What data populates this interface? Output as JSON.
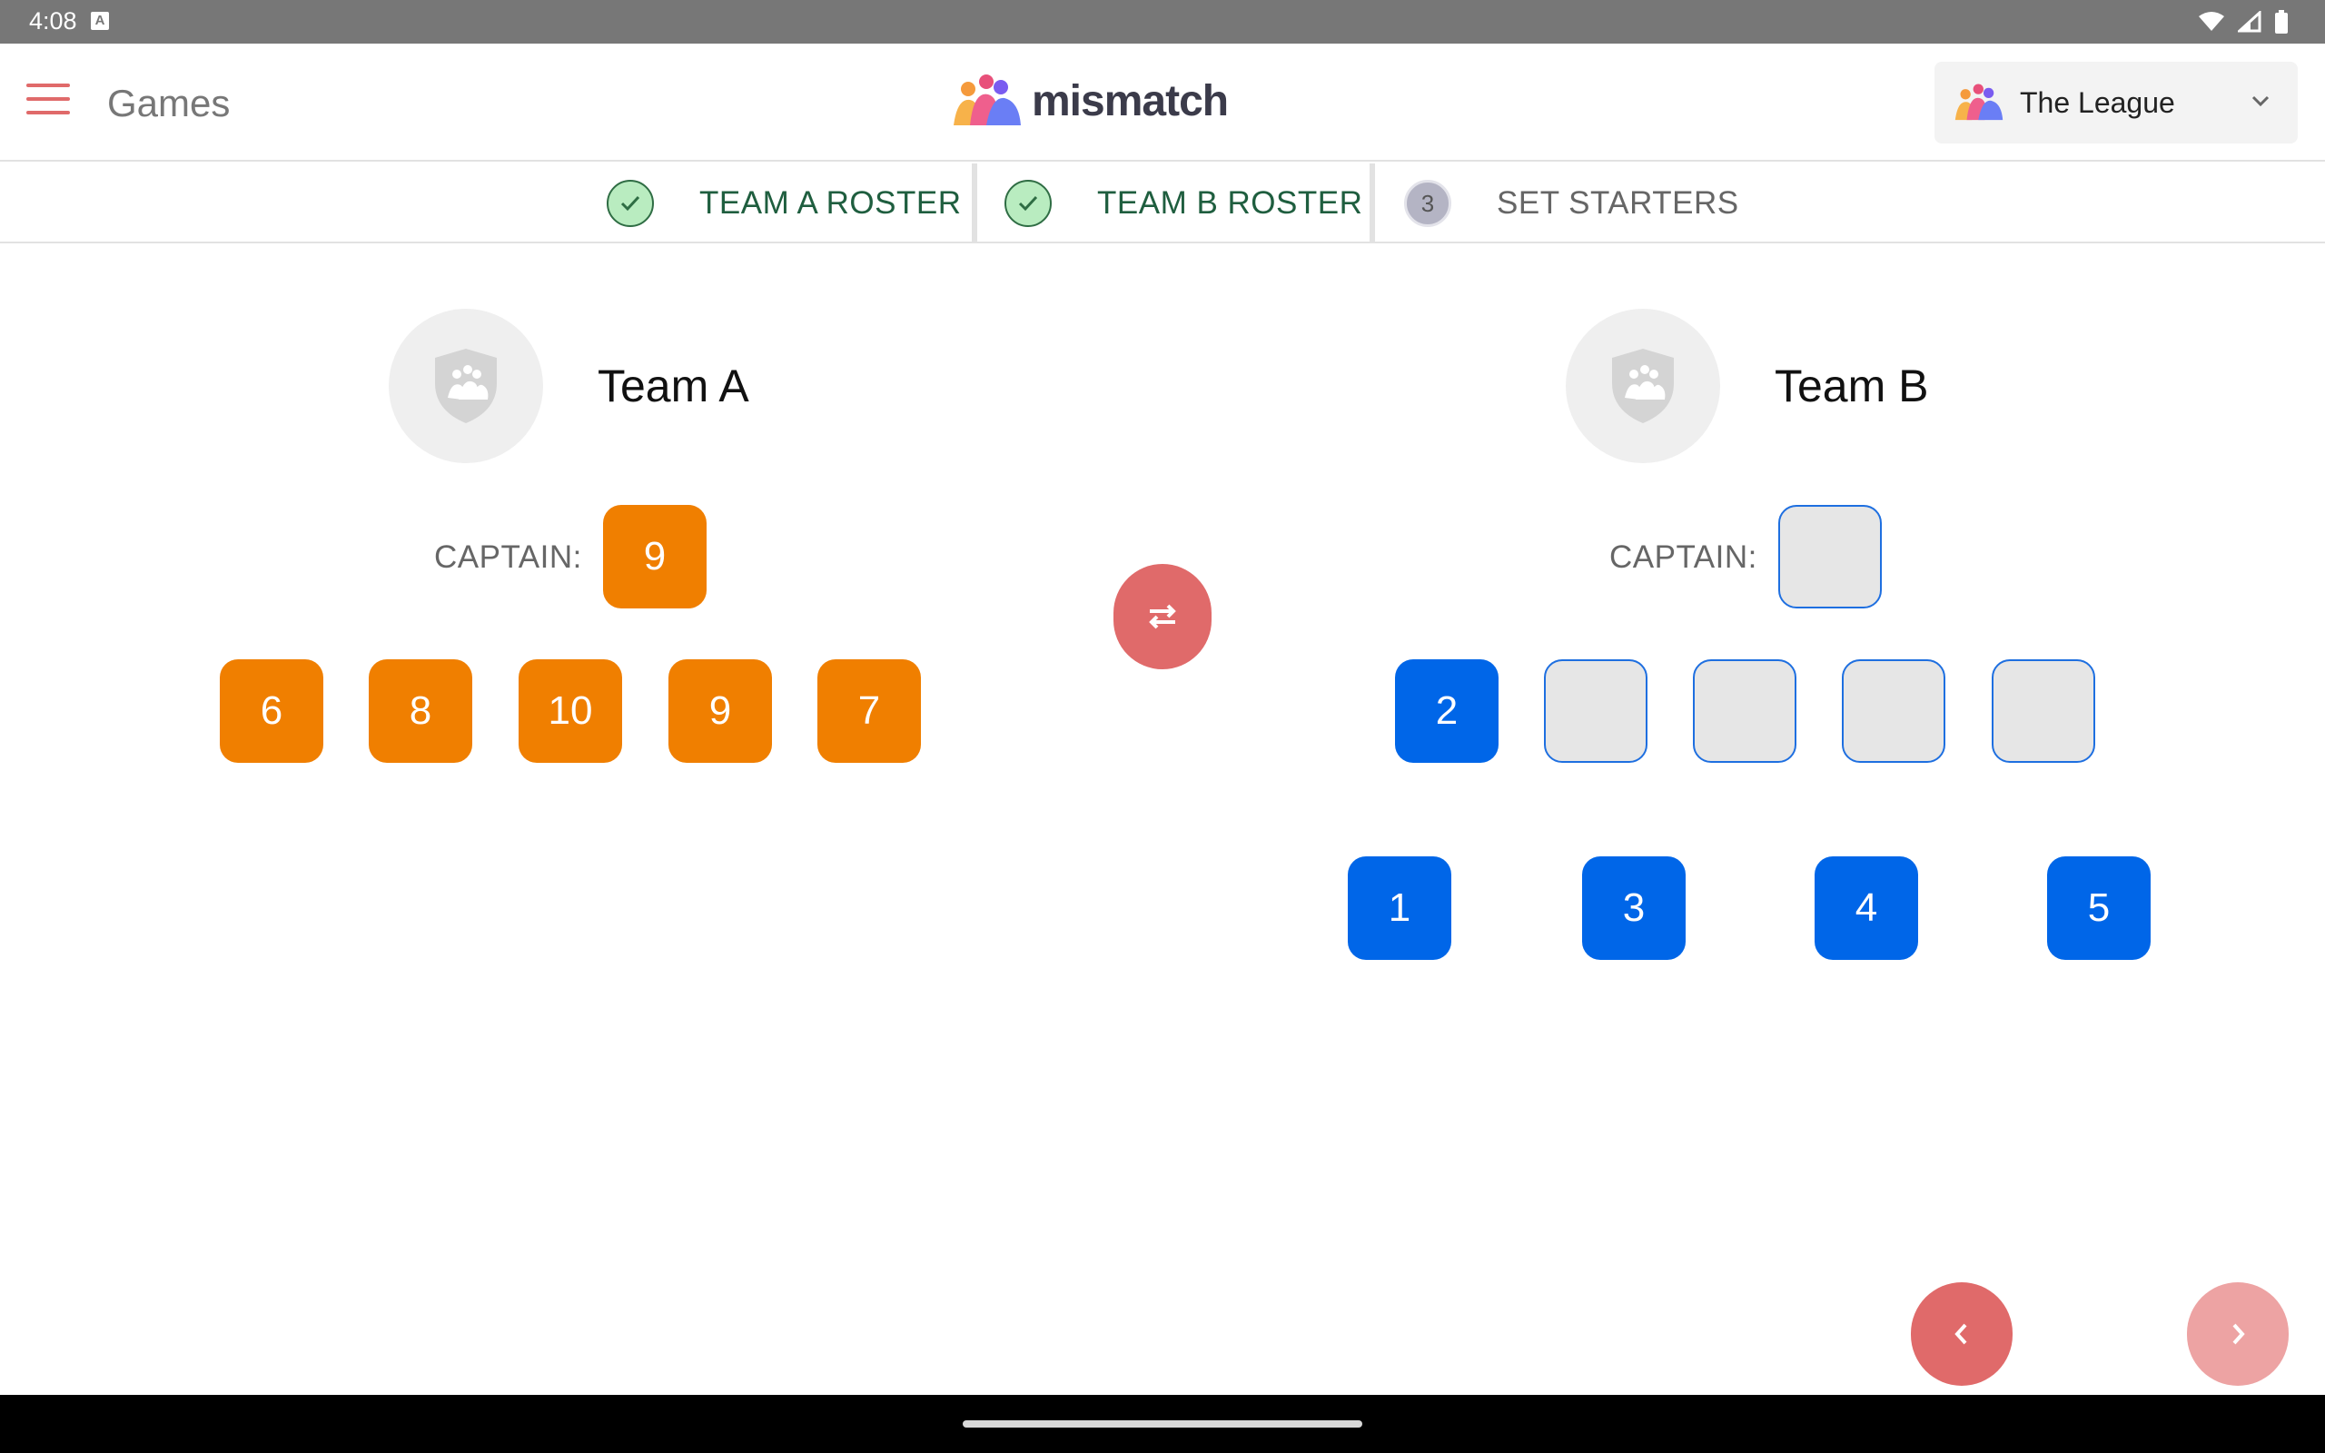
{
  "status_bar": {
    "time": "4:08",
    "notification_letter": "A"
  },
  "app_bar": {
    "title": "Games",
    "logo_text": "mismatch",
    "league_selector": {
      "selected": "The League"
    }
  },
  "stepper": {
    "steps": [
      {
        "label": "TEAM A ROSTER",
        "state": "done"
      },
      {
        "label": "TEAM B ROSTER",
        "state": "done"
      },
      {
        "label": "SET STARTERS",
        "state": "current",
        "number": "3"
      }
    ]
  },
  "team_a": {
    "name": "Team A",
    "captain_label": "CAPTAIN:",
    "captain": "9",
    "starters": [
      "6",
      "8",
      "10",
      "9",
      "7"
    ],
    "color": "#f07f00"
  },
  "team_b": {
    "name": "Team B",
    "captain_label": "CAPTAIN:",
    "captain": "",
    "starters": [
      "2",
      "",
      "",
      "",
      ""
    ],
    "bench": [
      "1",
      "3",
      "4",
      "5"
    ],
    "color": "#0066e8"
  },
  "colors": {
    "accent": "#e06a6a",
    "done_green": "#1f5e3f",
    "done_circle": "#b9ecc0"
  },
  "icons": {
    "menu": "hamburger-icon",
    "swap": "swap-horizontal-icon",
    "back": "chevron-left-icon",
    "next": "chevron-right-icon"
  }
}
